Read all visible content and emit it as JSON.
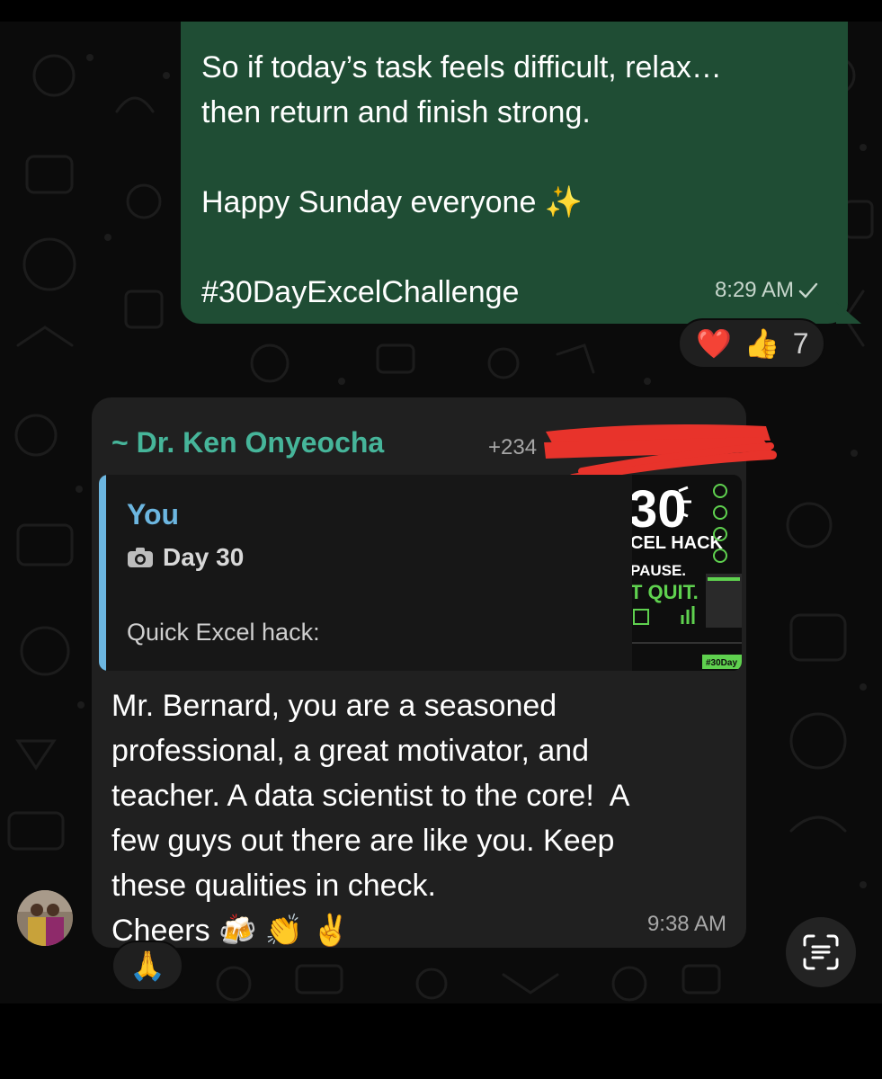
{
  "outgoing_message": {
    "lines": [
      "So if today’s task feels difficult, relax…",
      "then return and finish strong.",
      "",
      "Happy Sunday everyone ✨",
      "",
      "#30DayExcelChallenge"
    ],
    "time": "8:29 AM",
    "status_icon": "check-icon"
  },
  "outgoing_reactions": {
    "emojis": [
      "❤️",
      "👍"
    ],
    "count": "7"
  },
  "incoming_message": {
    "sender_name": "~ Dr. Ken Onyeocha",
    "sender_phone": "+234",
    "quoted": {
      "author": "You",
      "title": "Day 30",
      "title_icon": "camera-icon",
      "snippet": "Quick Excel hack:",
      "thumbnail": {
        "big_number": "30",
        "line1": "CEL HACK",
        "line2": "PAUSE.",
        "line3": "T QUIT.",
        "hashtag": "#30Day"
      }
    },
    "body_lines": [
      "Mr. Bernard, you are a seasoned",
      "professional, a great motivator, and",
      "teacher. A data scientist to the core!  A",
      "few guys out there are like you. Keep",
      "these qualities in check.",
      "Cheers 🍻 👏 ✌️"
    ],
    "time": "9:38 AM"
  },
  "incoming_reaction": {
    "emoji": "🙏"
  },
  "colors": {
    "outgoing_bubble": "#1f4d34",
    "incoming_bubble": "#202020",
    "sender_name": "#46b59a",
    "quote_accent": "#6cb6e0",
    "redaction": "#e8332b"
  }
}
